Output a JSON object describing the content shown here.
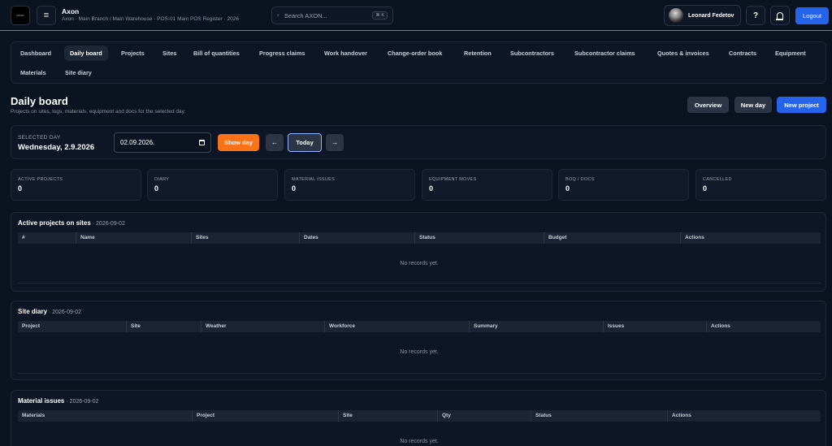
{
  "header": {
    "logo_text": "AXON",
    "app_title": "Axon",
    "app_subtitle": "Axon · Main Branch / Main Warehouse · POS-01 Main POS Register · 2026",
    "search_placeholder": "Search AXON...",
    "search_shortcut": "⌘ K",
    "user_name": "Leonard Fedetov",
    "help_label": "?",
    "logout_label": "Logout"
  },
  "nav": {
    "items": [
      {
        "label": "Dashboard"
      },
      {
        "label": "Daily board",
        "active": true
      },
      {
        "label": "Projects"
      },
      {
        "label": "Sites"
      },
      {
        "label": "Bill of quantities"
      },
      {
        "label": "Progress claims"
      },
      {
        "label": "Work handover"
      },
      {
        "label": "Change-order book"
      },
      {
        "label": "Retention"
      },
      {
        "label": "Subcontractors"
      },
      {
        "label": "Subcontractor claims"
      },
      {
        "label": "Quotes & invoices"
      },
      {
        "label": "Contracts"
      },
      {
        "label": "Equipment"
      },
      {
        "label": "Materials"
      },
      {
        "label": "Site diary"
      }
    ]
  },
  "page": {
    "title": "Daily board",
    "subtitle": "Projects on sites, logs, materials, equipment and docs for the selected day.",
    "overview_label": "Overview",
    "new_day_label": "New day",
    "new_project_label": "New project"
  },
  "day": {
    "selected_label": "SELECTED DAY",
    "selected_value": "Wednesday, 2.9.2026",
    "date_value": "02.09.2026.",
    "show_day_label": "Show day",
    "prev_label": "←",
    "today_label": "Today",
    "next_label": "→"
  },
  "stats": [
    {
      "label": "ACTIVE PROJECTS",
      "value": "0"
    },
    {
      "label": "DIARY",
      "value": "0"
    },
    {
      "label": "MATERIAL ISSUES",
      "value": "0"
    },
    {
      "label": "EQUIPMENT MOVES",
      "value": "0"
    },
    {
      "label": "BOQ / DOCS",
      "value": "0"
    },
    {
      "label": "CANCELLED",
      "value": "0"
    }
  ],
  "sections": [
    {
      "title": "Active projects on sites",
      "date": " · 2026-09-02",
      "columns": [
        "#",
        "Name",
        "Sites",
        "Dates",
        "Status",
        "Budget",
        "Actions"
      ],
      "empty": "No records yet."
    },
    {
      "title": "Site diary",
      "date": " · 2026-09-02",
      "columns": [
        "Project",
        "Site",
        "Weather",
        "Workforce",
        "Summary",
        "Issues",
        "Actions"
      ],
      "empty": "No records yet."
    },
    {
      "title": "Material issues",
      "date": " · 2026-09-02",
      "columns": [
        "Materials",
        "Project",
        "Site",
        "Qty",
        "Status",
        "Actions"
      ],
      "empty": "No records yet."
    }
  ]
}
